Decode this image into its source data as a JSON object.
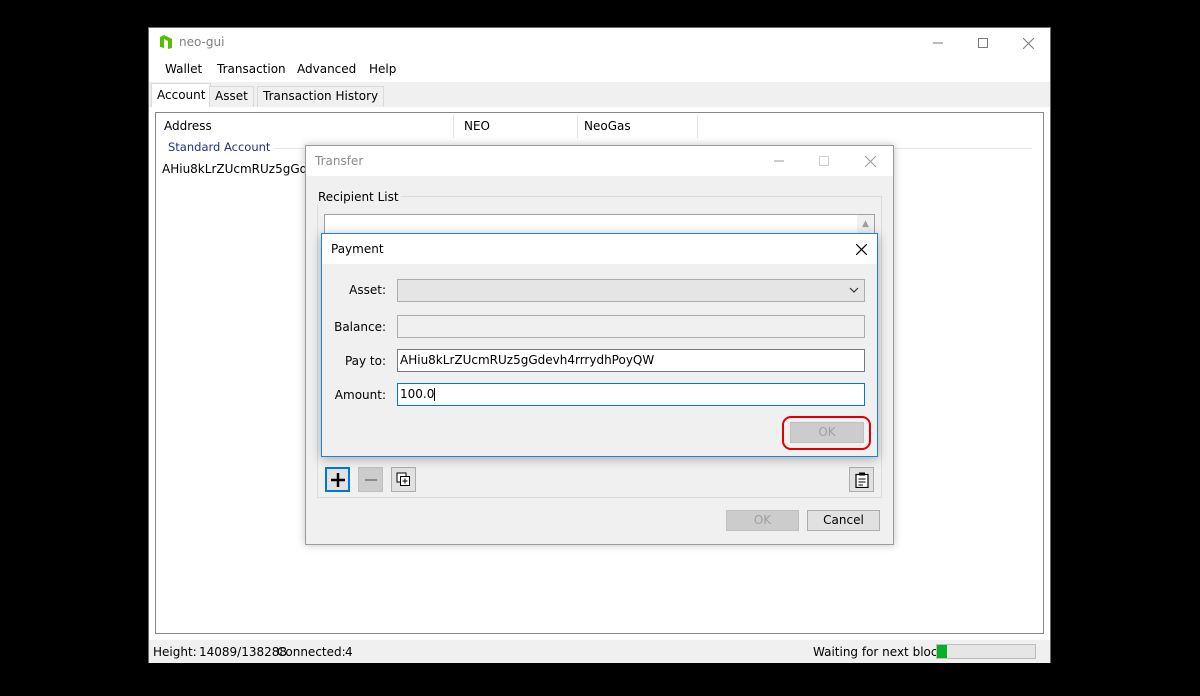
{
  "window": {
    "title": "neo-gui"
  },
  "menu": [
    "Wallet",
    "Transaction",
    "Advanced",
    "Help"
  ],
  "tabs": [
    "Account",
    "Asset",
    "Transaction History"
  ],
  "accounts_table": {
    "columns": [
      "Address",
      "NEO",
      "NeoGas"
    ],
    "group": "Standard Account",
    "rows": [
      {
        "address": "AHiu8kLrZUcmRUz5gGdevh4rrrydhPoyQW"
      }
    ]
  },
  "status": {
    "height_label": "Height:",
    "height_value": "14089/138288",
    "connected_label": "Connected:",
    "connected_value": "4",
    "next_block_label": "Waiting for next block:",
    "next_block_progress": 0.1
  },
  "transfer_dialog": {
    "title": "Transfer",
    "recipient_list_label": "Recipient List",
    "ok_label": "OK",
    "cancel_label": "Cancel"
  },
  "payment_dialog": {
    "title": "Payment",
    "asset_label": "Asset:",
    "asset_value": "",
    "balance_label": "Balance:",
    "balance_value": "",
    "pay_to_label": "Pay to:",
    "pay_to_value": "AHiu8kLrZUcmRUz5gGdevh4rrrydhPoyQW",
    "amount_label": "Amount:",
    "amount_value": "100.0",
    "ok_label": "OK"
  },
  "colors": {
    "accent": "#0078d7",
    "highlight": "#e00000",
    "progress": "#06b025",
    "group_header": "#1e3287"
  }
}
